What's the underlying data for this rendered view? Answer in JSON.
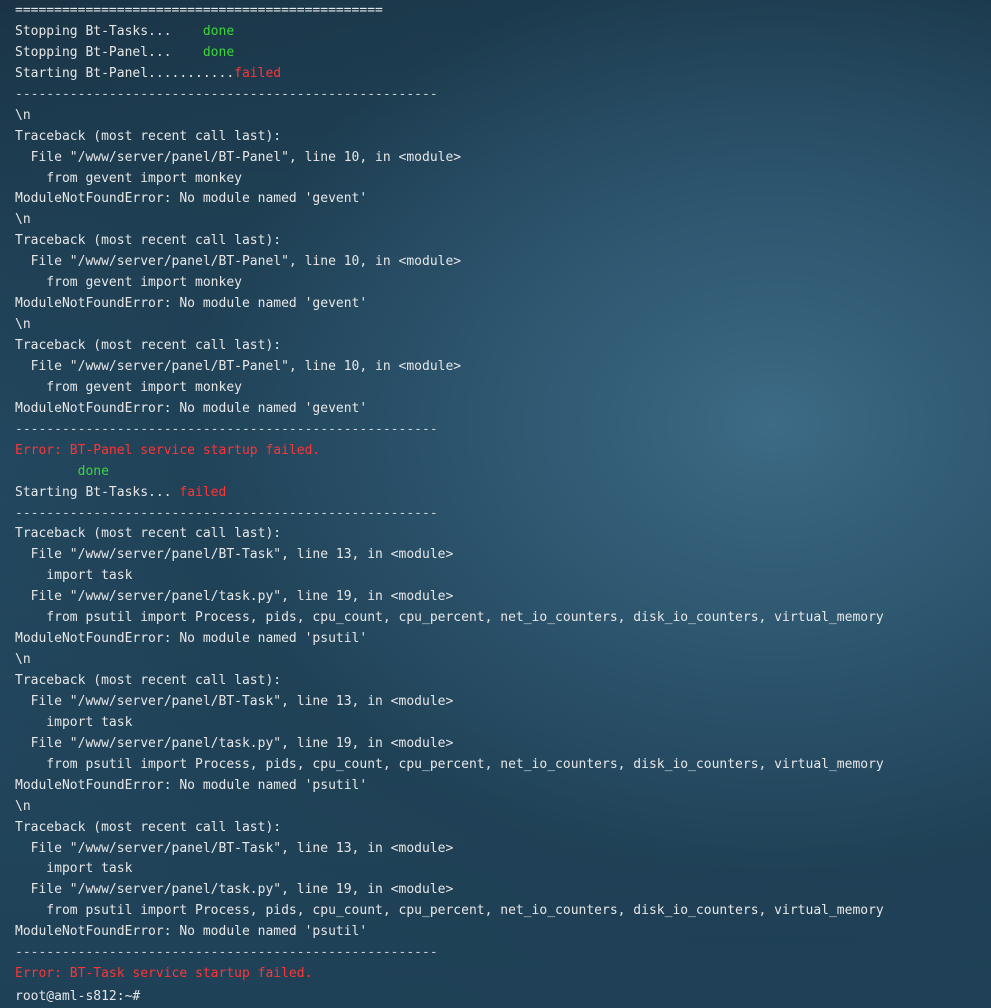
{
  "terminal": {
    "lines": [
      {
        "text": "===============================================",
        "color": "#e6e6e6"
      },
      {
        "parts": [
          {
            "text": "Stopping Bt-Tasks...    "
          },
          {
            "text": "done",
            "cls": "green"
          }
        ]
      },
      {
        "parts": [
          {
            "text": "Stopping Bt-Panel...    "
          },
          {
            "text": "done",
            "cls": "green"
          }
        ]
      },
      {
        "parts": [
          {
            "text": "Starting Bt-Panel..........."
          },
          {
            "text": "failed",
            "cls": "red"
          }
        ]
      },
      {
        "text": "------------------------------------------------------",
        "cls": "dim"
      },
      {
        "text": "\\n"
      },
      {
        "text": "Traceback (most recent call last):"
      },
      {
        "text": "  File \"/www/server/panel/BT-Panel\", line 10, in <module>"
      },
      {
        "text": "    from gevent import monkey"
      },
      {
        "text": "ModuleNotFoundError: No module named 'gevent'"
      },
      {
        "text": "\\n"
      },
      {
        "text": "Traceback (most recent call last):"
      },
      {
        "text": "  File \"/www/server/panel/BT-Panel\", line 10, in <module>"
      },
      {
        "text": "    from gevent import monkey"
      },
      {
        "text": "ModuleNotFoundError: No module named 'gevent'"
      },
      {
        "text": "\\n"
      },
      {
        "text": "Traceback (most recent call last):"
      },
      {
        "text": "  File \"/www/server/panel/BT-Panel\", line 10, in <module>"
      },
      {
        "text": "    from gevent import monkey"
      },
      {
        "text": "ModuleNotFoundError: No module named 'gevent'"
      },
      {
        "text": "------------------------------------------------------",
        "cls": "dim"
      },
      {
        "text": "Error: BT-Panel service startup failed.",
        "cls": "red"
      },
      {
        "parts": [
          {
            "text": "        "
          },
          {
            "text": "done",
            "cls": "green"
          }
        ]
      },
      {
        "parts": [
          {
            "text": "Starting Bt-Tasks... "
          },
          {
            "text": "failed",
            "cls": "red"
          }
        ]
      },
      {
        "text": "------------------------------------------------------",
        "cls": "dim"
      },
      {
        "text": "Traceback (most recent call last):"
      },
      {
        "text": "  File \"/www/server/panel/BT-Task\", line 13, in <module>"
      },
      {
        "text": "    import task"
      },
      {
        "text": "  File \"/www/server/panel/task.py\", line 19, in <module>"
      },
      {
        "text": "    from psutil import Process, pids, cpu_count, cpu_percent, net_io_counters, disk_io_counters, virtual_memory"
      },
      {
        "text": "ModuleNotFoundError: No module named 'psutil'"
      },
      {
        "text": "\\n"
      },
      {
        "text": "Traceback (most recent call last):"
      },
      {
        "text": "  File \"/www/server/panel/BT-Task\", line 13, in <module>"
      },
      {
        "text": "    import task"
      },
      {
        "text": "  File \"/www/server/panel/task.py\", line 19, in <module>"
      },
      {
        "text": "    from psutil import Process, pids, cpu_count, cpu_percent, net_io_counters, disk_io_counters, virtual_memory"
      },
      {
        "text": "ModuleNotFoundError: No module named 'psutil'"
      },
      {
        "text": "\\n"
      },
      {
        "text": "Traceback (most recent call last):"
      },
      {
        "text": "  File \"/www/server/panel/BT-Task\", line 13, in <module>"
      },
      {
        "text": "    import task"
      },
      {
        "text": "  File \"/www/server/panel/task.py\", line 19, in <module>"
      },
      {
        "text": "    from psutil import Process, pids, cpu_count, cpu_percent, net_io_counters, disk_io_counters, virtual_memory"
      },
      {
        "text": "ModuleNotFoundError: No module named 'psutil'"
      },
      {
        "text": "------------------------------------------------------",
        "cls": "dim"
      },
      {
        "text": "Error: BT-Task service startup failed.",
        "cls": "red"
      }
    ],
    "prompt": "root@aml-s812:~#"
  },
  "colors": {
    "success": "#3cd63c",
    "error": "#ff3434",
    "foreground": "#e6e6e6"
  }
}
